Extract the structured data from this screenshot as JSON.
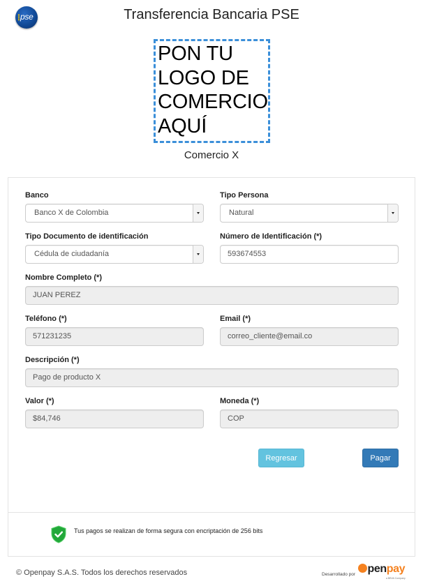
{
  "header": {
    "logo_label": "pse",
    "title": "Transferencia Bancaria PSE"
  },
  "merchant": {
    "logo_placeholder_lines": [
      "PON TU",
      "LOGO DE",
      "COMERCIO",
      "AQUÍ"
    ],
    "name": "Comercio X"
  },
  "form": {
    "bank": {
      "label": "Banco",
      "value": "Banco X de Colombia"
    },
    "person_type": {
      "label": "Tipo Persona",
      "value": "Natural"
    },
    "document_type": {
      "label": "Tipo Documento de identificación",
      "value": "Cédula de ciudadanía"
    },
    "document_number": {
      "label": "Número de Identificación (*)",
      "value": "593674553"
    },
    "full_name": {
      "label": "Nombre Completo (*)",
      "value": "JUAN PEREZ"
    },
    "phone": {
      "label": "Teléfono (*)",
      "value": "571231235"
    },
    "email": {
      "label": "Email (*)",
      "value": "correo_cliente@email.co"
    },
    "description": {
      "label": "Descripción (*)",
      "value": "Pago de producto X"
    },
    "amount": {
      "label": "Valor (*)",
      "value": "$84,746"
    },
    "currency": {
      "label": "Moneda (*)",
      "value": "COP"
    },
    "buttons": {
      "back": "Regresar",
      "pay": "Pagar"
    }
  },
  "security": {
    "icon": "shield-check-icon",
    "message": "Tus pagos se realizan de forma segura con encriptación de 256 bits"
  },
  "footer": {
    "copyright": "© Openpay S.A.S. Todos los derechos reservados",
    "developed_by": "Desarrollado por",
    "brand_open": "pen",
    "brand_pay": "pay",
    "brand_sub": "a BBVA Company"
  },
  "colors": {
    "primary": "#337ab7",
    "info": "#5bc0de",
    "dashed_border": "#3b8fd9",
    "shield": "#22a83a",
    "openpay_orange": "#f58220"
  }
}
